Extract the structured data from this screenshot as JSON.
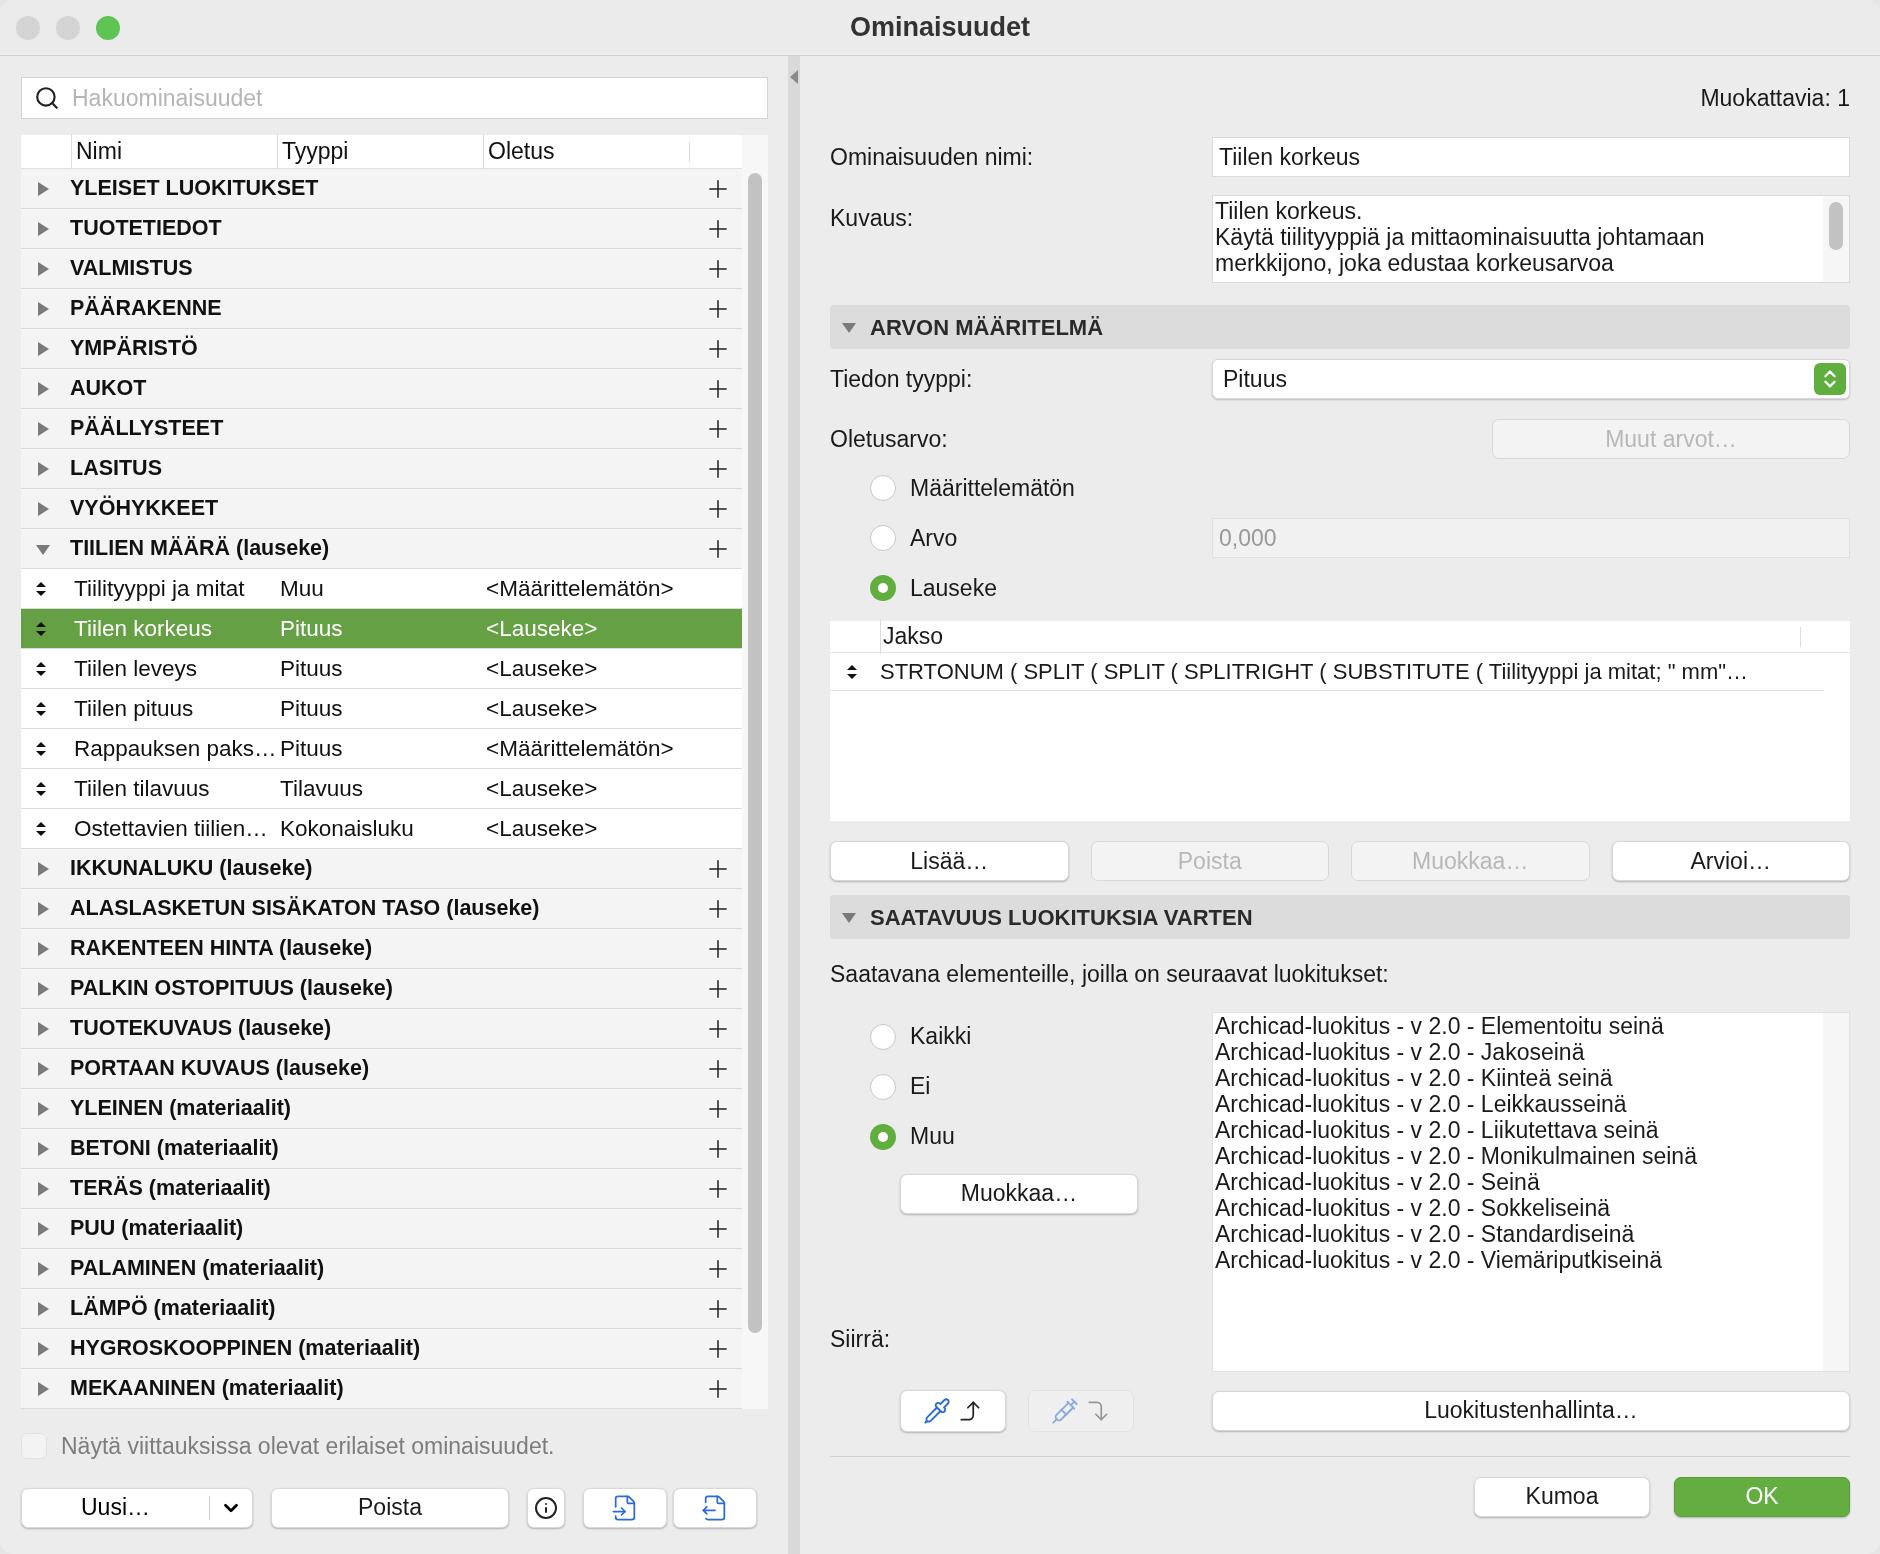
{
  "window": {
    "title": "Ominaisuudet",
    "controls": [
      {
        "color": "#d4d4d4"
      },
      {
        "color": "#d4d4d4"
      },
      {
        "color": "#5fc454"
      }
    ]
  },
  "search": {
    "placeholder": "Hakuominaisuudet"
  },
  "tree": {
    "columns": [
      "Nimi",
      "Tyyppi",
      "Oletus"
    ],
    "groups": [
      {
        "name": "YLEISET LUOKITUKSET",
        "expanded": false
      },
      {
        "name": "TUOTETIEDOT",
        "expanded": false
      },
      {
        "name": "VALMISTUS",
        "expanded": false
      },
      {
        "name": "PÄÄRAKENNE",
        "expanded": false
      },
      {
        "name": "YMPÄRISTÖ",
        "expanded": false
      },
      {
        "name": "AUKOT",
        "expanded": false
      },
      {
        "name": "PÄÄLLYSTEET",
        "expanded": false
      },
      {
        "name": "LASITUS",
        "expanded": false
      },
      {
        "name": "VYÖHYKKEET",
        "expanded": false
      },
      {
        "name": "TIILIEN MÄÄRÄ (lauseke)",
        "expanded": true,
        "children": [
          {
            "name": "Tiilityyppi ja mitat",
            "type": "Muu",
            "default": "<Määrittelemätön>",
            "selected": false
          },
          {
            "name": "Tiilen korkeus",
            "type": "Pituus",
            "default": "<Lauseke>",
            "selected": true
          },
          {
            "name": "Tiilen leveys",
            "type": "Pituus",
            "default": "<Lauseke>",
            "selected": false
          },
          {
            "name": "Tiilen pituus",
            "type": "Pituus",
            "default": "<Lauseke>",
            "selected": false
          },
          {
            "name": "Rappauksen paks…",
            "type": "Pituus",
            "default": "<Määrittelemätön>",
            "selected": false
          },
          {
            "name": "Tiilen tilavuus",
            "type": "Tilavuus",
            "default": "<Lauseke>",
            "selected": false
          },
          {
            "name": "Ostettavien tiilien…",
            "type": "Kokonaisluku",
            "default": "<Lauseke>",
            "selected": false
          }
        ]
      },
      {
        "name": "IKKUNALUKU (lauseke)",
        "expanded": false
      },
      {
        "name": "ALASLASKETUN SISÄKATON TASO (lauseke)",
        "expanded": false
      },
      {
        "name": "RAKENTEEN HINTA (lauseke)",
        "expanded": false
      },
      {
        "name": "PALKIN OSTOPITUUS (lauseke)",
        "expanded": false
      },
      {
        "name": "TUOTEKUVAUS (lauseke)",
        "expanded": false
      },
      {
        "name": "PORTAAN KUVAUS (lauseke)",
        "expanded": false
      },
      {
        "name": "YLEINEN (materiaalit)",
        "expanded": false
      },
      {
        "name": "BETONI (materiaalit)",
        "expanded": false
      },
      {
        "name": "TERÄS (materiaalit)",
        "expanded": false
      },
      {
        "name": "PUU (materiaalit)",
        "expanded": false
      },
      {
        "name": "PALAMINEN (materiaalit)",
        "expanded": false
      },
      {
        "name": "LÄMPÖ (materiaalit)",
        "expanded": false
      },
      {
        "name": "HYGROSKOOPPINEN (materiaalit)",
        "expanded": false
      },
      {
        "name": "MEKAANINEN (materiaalit)",
        "expanded": false
      }
    ]
  },
  "show_differing": {
    "label": "Näytä viittauksissa olevat erilaiset ominaisuudet.",
    "checked": false,
    "disabled": true
  },
  "left_buttons": {
    "new": "Uusi…",
    "delete": "Poista"
  },
  "editable_count": "Muokattavia: 1",
  "name_field": {
    "label": "Ominaisuuden nimi:",
    "value": "Tiilen korkeus"
  },
  "description": {
    "label": "Kuvaus:",
    "lines": [
      "Tiilen korkeus.",
      "Käytä tiilityyppiä ja mittaominaisuutta johtamaan",
      "merkkijono, joka edustaa korkeusarvoa"
    ]
  },
  "value_definition": {
    "title": "ARVON MÄÄRITELMÄ",
    "expanded": true,
    "data_type": {
      "label": "Tiedon tyyppi:",
      "value": "Pituus"
    },
    "default_label": "Oletusarvo:",
    "more_button": {
      "label": "Muut arvot…",
      "disabled": true
    },
    "options": [
      {
        "label": "Määrittelemätön",
        "selected": false
      },
      {
        "label": "Arvo",
        "selected": false,
        "value": "0,000",
        "disabled": true
      },
      {
        "label": "Lauseke",
        "selected": true
      }
    ],
    "expressions": {
      "column": "Jakso",
      "rows": [
        "STRTONUM ( SPLIT ( SPLIT ( SPLITRIGHT ( SUBSTITUTE ( Tiilityyppi ja mitat; \" mm\"…"
      ]
    },
    "buttons": [
      {
        "label": "Lisää…",
        "disabled": false
      },
      {
        "label": "Poista",
        "disabled": true
      },
      {
        "label": "Muokkaa…",
        "disabled": true
      },
      {
        "label": "Arvioi…",
        "disabled": false
      }
    ]
  },
  "availability": {
    "title": "SAATAVUUS LUOKITUKSIA VARTEN",
    "expanded": true,
    "intro": "Saatavana elementeille, joilla on seuraavat luokitukset:",
    "options": [
      {
        "label": "Kaikki",
        "selected": false
      },
      {
        "label": "Ei",
        "selected": false
      },
      {
        "label": "Muu",
        "selected": true
      }
    ],
    "edit_button": {
      "label": "Muokkaa…",
      "disabled": false
    },
    "classifications": [
      "Archicad-luokitus - v 2.0 - Elementoitu seinä",
      "Archicad-luokitus - v 2.0 - Jakoseinä",
      "Archicad-luokitus - v 2.0 - Kiinteä seinä",
      "Archicad-luokitus - v 2.0 - Leikkausseinä",
      "Archicad-luokitus - v 2.0 - Liikutettava seinä",
      "Archicad-luokitus - v 2.0 - Monikulmainen seinä",
      "Archicad-luokitus - v 2.0 - Seinä",
      "Archicad-luokitus - v 2.0 - Sokkeliseinä",
      "Archicad-luokitus - v 2.0 - Standardiseinä",
      "Archicad-luokitus - v 2.0 - Viemäriputkiseinä"
    ],
    "move_label": "Siirrä:",
    "transfer_buttons": [
      {
        "kind": "pick",
        "disabled": false
      },
      {
        "kind": "inject",
        "disabled": true
      }
    ],
    "manager_button": "Luokitustenhallinta…"
  },
  "footer": [
    {
      "label": "Kumoa",
      "kind": "secondary"
    },
    {
      "label": "OK",
      "kind": "primary"
    }
  ]
}
